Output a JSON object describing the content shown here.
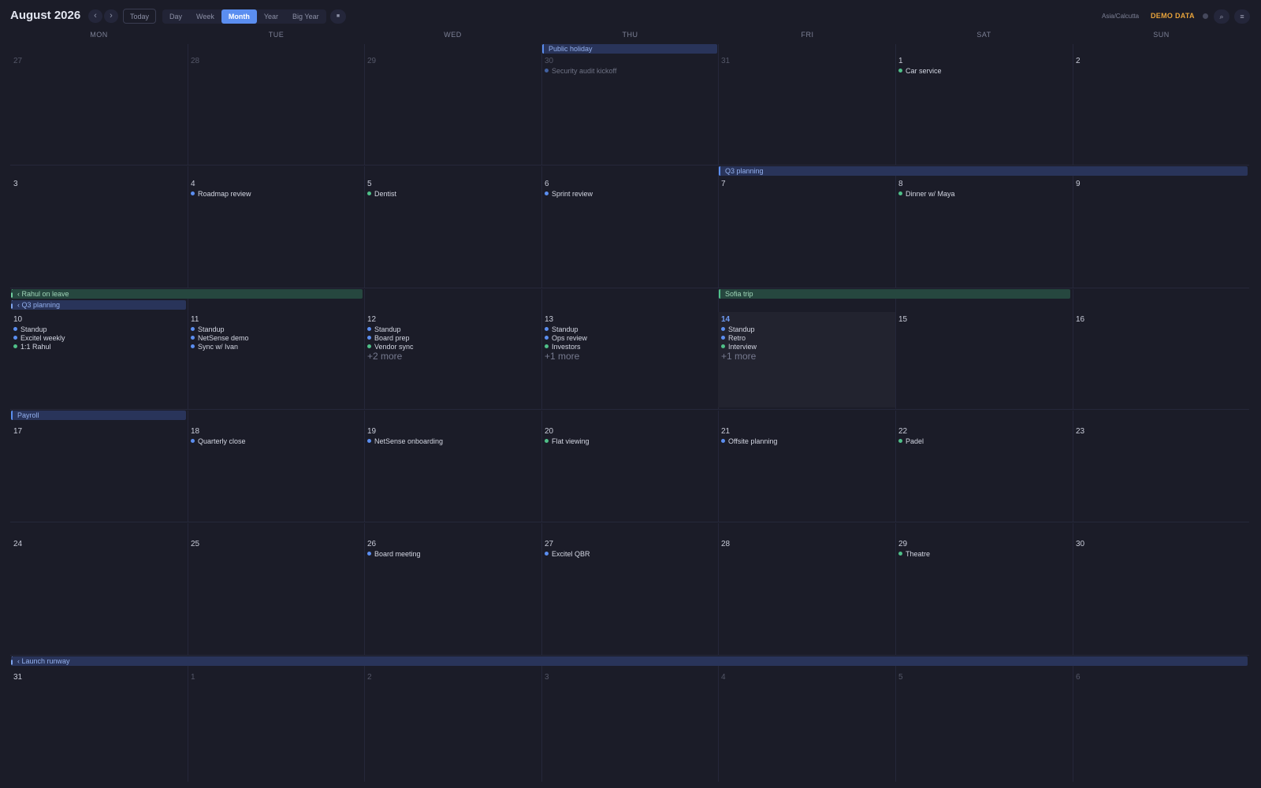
{
  "toolbar": {
    "title": "August 2026",
    "prev_label": "‹",
    "next_label": "›",
    "today_label": "Today",
    "views": [
      "Day",
      "Week",
      "Month",
      "Year",
      "Big Year"
    ],
    "active_view": "Month",
    "extra_label": "■",
    "timezone": "Asia/Calcutta",
    "demo_label": "DEMO DATA",
    "search_icon": "⌕",
    "menu_icon": "≡"
  },
  "colors": {
    "accent": "#5b8ef0",
    "demo": "#e8a33b",
    "event_blue": "#5b8ef0",
    "event_green": "#4fbf88"
  },
  "weekdays": [
    "MON",
    "TUE",
    "WED",
    "THU",
    "FRI",
    "SAT",
    "SUN"
  ],
  "weeks": [
    {
      "spans": [
        {
          "label": "Public holiday",
          "start": 3,
          "len": 1,
          "lane": 0,
          "color": "blue",
          "cont": false
        }
      ],
      "days": [
        {
          "num": "27",
          "dim": true,
          "events": []
        },
        {
          "num": "28",
          "dim": true,
          "events": []
        },
        {
          "num": "29",
          "dim": true,
          "events": []
        },
        {
          "num": "30",
          "dim": true,
          "events": [
            {
              "label": "Security audit kickoff",
              "color": "blue"
            }
          ]
        },
        {
          "num": "31",
          "dim": true,
          "events": []
        },
        {
          "num": "1",
          "events": [
            {
              "label": "Car service",
              "color": "green"
            }
          ]
        },
        {
          "num": "2",
          "events": []
        }
      ]
    },
    {
      "spans": [
        {
          "label": "Q3 planning",
          "start": 4,
          "len": 3,
          "lane": 0,
          "color": "blue",
          "cont": false
        }
      ],
      "days": [
        {
          "num": "3",
          "events": []
        },
        {
          "num": "4",
          "events": [
            {
              "label": "Roadmap review",
              "color": "blue"
            }
          ]
        },
        {
          "num": "5",
          "events": [
            {
              "label": "Dentist",
              "color": "green"
            }
          ]
        },
        {
          "num": "6",
          "events": [
            {
              "label": "Sprint review",
              "color": "blue"
            }
          ]
        },
        {
          "num": "7",
          "events": []
        },
        {
          "num": "8",
          "events": [
            {
              "label": "Dinner w/ Maya",
              "color": "green"
            }
          ]
        },
        {
          "num": "9",
          "events": []
        }
      ]
    },
    {
      "spans": [
        {
          "label": "‹ Rahul on leave",
          "start": 0,
          "len": 2,
          "lane": 0,
          "color": "green",
          "cont": true
        },
        {
          "label": "Sofia trip",
          "start": 4,
          "len": 2,
          "lane": 0,
          "color": "green",
          "cont": false
        },
        {
          "label": "‹ Q3 planning",
          "start": 0,
          "len": 1,
          "lane": 1,
          "color": "blue",
          "cont": true
        }
      ],
      "days": [
        {
          "num": "10",
          "events": [
            {
              "label": "Standup",
              "color": "blue"
            },
            {
              "label": "Excitel weekly",
              "color": "blue"
            },
            {
              "label": "1:1 Rahul",
              "color": "green"
            }
          ]
        },
        {
          "num": "11",
          "events": [
            {
              "label": "Standup",
              "color": "blue"
            },
            {
              "label": "NetSense demo",
              "color": "blue"
            },
            {
              "label": "Sync w/ Ivan",
              "color": "blue"
            }
          ]
        },
        {
          "num": "12",
          "events": [
            {
              "label": "Standup",
              "color": "blue"
            },
            {
              "label": "Board prep",
              "color": "blue"
            },
            {
              "label": "Vendor sync",
              "color": "green"
            }
          ],
          "more": "+2 more"
        },
        {
          "num": "13",
          "events": [
            {
              "label": "Standup",
              "color": "blue"
            },
            {
              "label": "Ops review",
              "color": "blue"
            },
            {
              "label": "Investors",
              "color": "green"
            }
          ],
          "more": "+1 more"
        },
        {
          "num": "14",
          "today": true,
          "events": [
            {
              "label": "Standup",
              "color": "blue"
            },
            {
              "label": "Retro",
              "color": "blue"
            },
            {
              "label": "Interview",
              "color": "green"
            }
          ],
          "more": "+1 more"
        },
        {
          "num": "15",
          "events": []
        },
        {
          "num": "16",
          "events": []
        }
      ]
    },
    {
      "spans": [
        {
          "label": "Payroll",
          "start": 0,
          "len": 1,
          "lane": 0,
          "color": "blue",
          "cont": false
        }
      ],
      "days": [
        {
          "num": "17",
          "events": []
        },
        {
          "num": "18",
          "events": [
            {
              "label": "Quarterly close",
              "color": "blue"
            }
          ]
        },
        {
          "num": "19",
          "events": [
            {
              "label": "NetSense onboarding",
              "color": "blue"
            }
          ]
        },
        {
          "num": "20",
          "events": [
            {
              "label": "Flat viewing",
              "color": "green"
            }
          ]
        },
        {
          "num": "21",
          "events": [
            {
              "label": "Offsite planning",
              "color": "blue"
            }
          ]
        },
        {
          "num": "22",
          "events": [
            {
              "label": "Padel",
              "color": "green"
            }
          ]
        },
        {
          "num": "23",
          "events": []
        }
      ]
    },
    {
      "spans": [],
      "days": [
        {
          "num": "24",
          "events": []
        },
        {
          "num": "25",
          "events": []
        },
        {
          "num": "26",
          "events": [
            {
              "label": "Board meeting",
              "color": "blue"
            }
          ]
        },
        {
          "num": "27",
          "events": [
            {
              "label": "Excitel QBR",
              "color": "blue"
            }
          ]
        },
        {
          "num": "28",
          "events": []
        },
        {
          "num": "29",
          "events": [
            {
              "label": "Theatre",
              "color": "green"
            }
          ]
        },
        {
          "num": "30",
          "events": []
        }
      ]
    },
    {
      "spans": [
        {
          "label": "‹ Launch runway",
          "start": 0,
          "len": 7,
          "lane": 0,
          "color": "blue",
          "cont": true
        }
      ],
      "days": [
        {
          "num": "31",
          "events": []
        },
        {
          "num": "1",
          "dim": true,
          "events": []
        },
        {
          "num": "2",
          "dim": true,
          "events": []
        },
        {
          "num": "3",
          "dim": true,
          "events": []
        },
        {
          "num": "4",
          "dim": true,
          "events": []
        },
        {
          "num": "5",
          "dim": true,
          "events": []
        },
        {
          "num": "6",
          "dim": true,
          "events": []
        }
      ]
    }
  ]
}
